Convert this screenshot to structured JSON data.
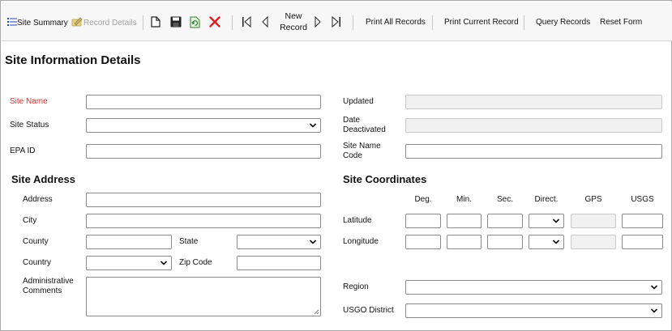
{
  "toolbar": {
    "site_summary": "Site Summary",
    "record_details": "Record Details",
    "new_record_line1": "New",
    "new_record_line2": "Record",
    "print_all": "Print All Records",
    "print_current": "Print Current Record",
    "query": "Query Records",
    "reset": "Reset Form"
  },
  "page_title": "Site Information Details",
  "left": {
    "site_name_label": "Site Name",
    "site_status_label": "Site Status",
    "epa_id_label": "EPA ID",
    "site_address_heading": "Site Address",
    "address_label": "Address",
    "city_label": "City",
    "county_label": "County",
    "state_label": "State",
    "country_label": "Country",
    "zip_label": "Zip Code",
    "admin_comments_label_1": "Administrative",
    "admin_comments_label_2": "Comments"
  },
  "right": {
    "updated_label": "Updated",
    "date_deactivated_label_1": "Date",
    "date_deactivated_label_2": "Deactivated",
    "site_name_code_label_1": "Site Name",
    "site_name_code_label_2": "Code",
    "coordinates_heading": "Site Coordinates",
    "col_deg": "Deg.",
    "col_min": "Min.",
    "col_sec": "Sec.",
    "col_direct": "Direct.",
    "col_gps": "GPS",
    "col_usgs": "USGS",
    "latitude_label": "Latitude",
    "longitude_label": "Longitude",
    "region_label": "Region",
    "usgo_district_label": "USGO District"
  },
  "colors": {
    "required": "#d32f2f",
    "delete_icon": "#e02020",
    "toolbar_bg": "#f7f7f7"
  }
}
